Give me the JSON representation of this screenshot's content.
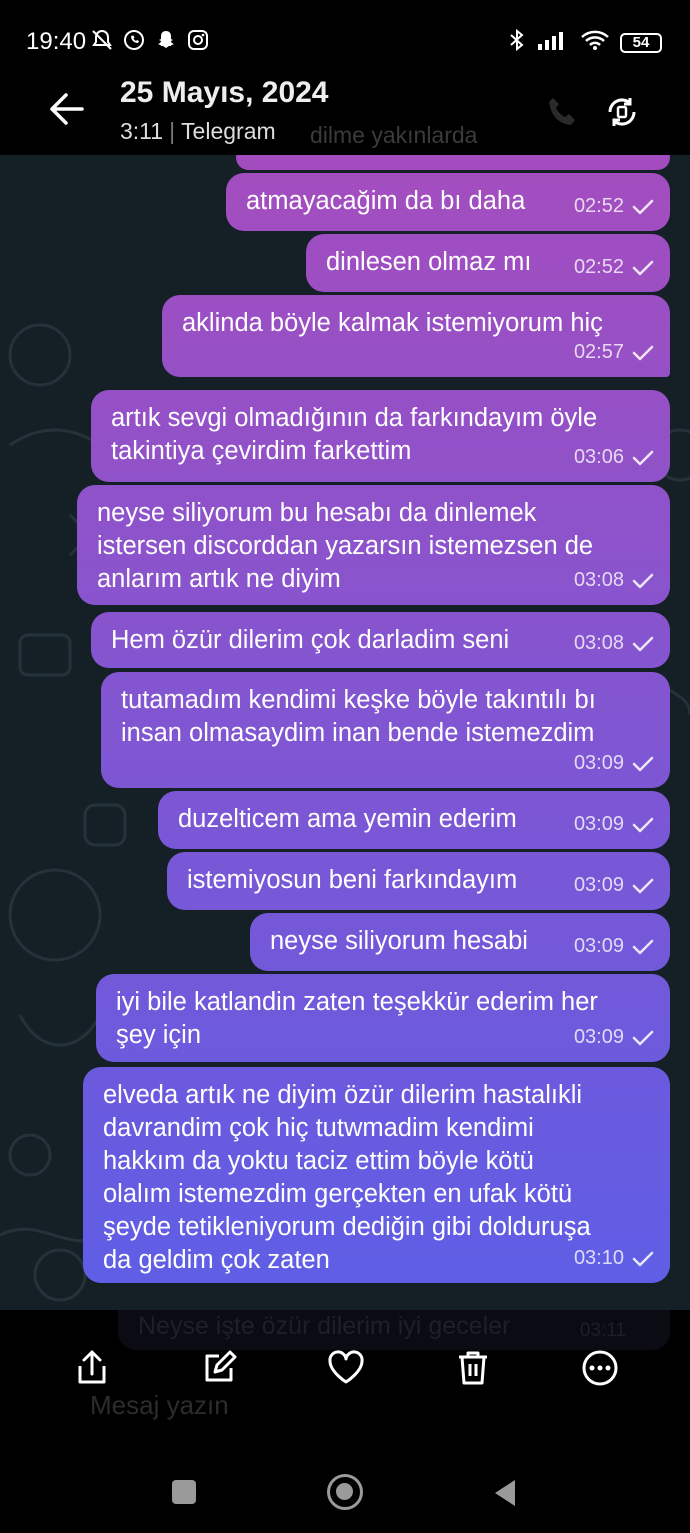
{
  "status_bar": {
    "time": "19:40",
    "battery": "54"
  },
  "header": {
    "title": "25 Mayıs, 2024",
    "time": "3:11",
    "app": "Telegram",
    "ghost_subtitle": "dilme yakınlarda"
  },
  "messages": [
    {
      "text": "atmayacağim da bı daha",
      "time": "02:52"
    },
    {
      "text": "dinlesen olmaz mı",
      "time": "02:52"
    },
    {
      "text": "aklinda böyle kalmak istemiyorum hiç",
      "time": "02:57"
    },
    {
      "text": "artık sevgi olmadığının da farkındayım öyle\ntakintiya çevirdim farkettim",
      "time": "03:06"
    },
    {
      "text": "neyse siliyorum bu hesabı da dinlemek\nistersen discorddan yazarsın istemezsen de\nanlarım artık ne diyim",
      "time": "03:08"
    },
    {
      "text": "Hem özür dilerim çok darladim seni",
      "time": "03:08"
    },
    {
      "text": "tutamadım kendimi keşke böyle takıntılı bı\ninsan olmasaydim inan bende istemezdim",
      "time": "03:09"
    },
    {
      "text": "duzelticem ama yemin ederim",
      "time": "03:09"
    },
    {
      "text": "istemiyosun beni farkındayım",
      "time": "03:09"
    },
    {
      "text": "neyse siliyorum hesabi",
      "time": "03:09"
    },
    {
      "text": "iyi bile katlandin zaten teşekkür ederim her\nşey için",
      "time": "03:09"
    },
    {
      "text": "elveda artık ne diyim özür dilerim hastalıkli\ndavrandim çok hiç tutwmadim kendimi\nhakkım da yoktu taciz ettim böyle kötü\nolalım istemezdim gerçekten en ufak kötü\nşeyde tetikleniyorum dediğin gibi dolduruşa\nda geldim çok zaten",
      "time": "03:10"
    }
  ],
  "ghost_last_message": {
    "text": "Neyse işte özür dilerim iyi geceler",
    "time": "03:11"
  },
  "ghost_input_placeholder": "Mesaj yazın",
  "colors": {
    "chat_background": "#152026",
    "bubble_top": "#a44dbe",
    "bubble_bottom": "#5d5ee6"
  }
}
